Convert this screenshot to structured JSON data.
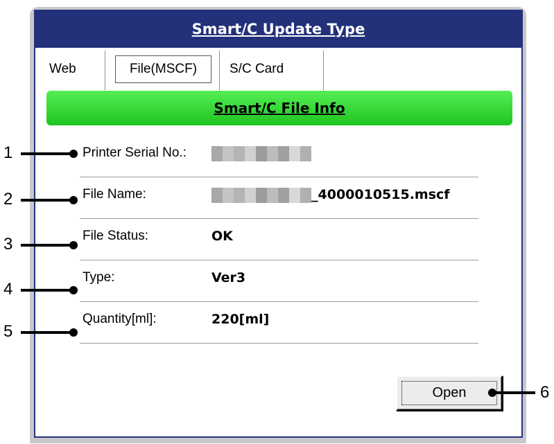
{
  "window": {
    "title": "Smart/C Update Type"
  },
  "tabs": [
    {
      "label": "Web"
    },
    {
      "label": "File(MSCF)"
    },
    {
      "label": "S/C Card"
    }
  ],
  "info_header": "Smart/C File Info",
  "rows": [
    {
      "label": "Printer Serial No.:",
      "value": "",
      "value_suffix": ""
    },
    {
      "label": "File Name:",
      "value": "",
      "value_suffix": "_4000010515.mscf"
    },
    {
      "label": "File Status:",
      "value": "OK",
      "value_suffix": ""
    },
    {
      "label": "Type:",
      "value": "Ver3",
      "value_suffix": ""
    },
    {
      "label": "Quantity[ml]:",
      "value": "220[ml]",
      "value_suffix": ""
    }
  ],
  "open_button": "Open",
  "callouts": [
    "1",
    "2",
    "3",
    "4",
    "5",
    "6"
  ],
  "colors": {
    "titlebar": "#23317a",
    "info_header": "#2ed62e"
  }
}
